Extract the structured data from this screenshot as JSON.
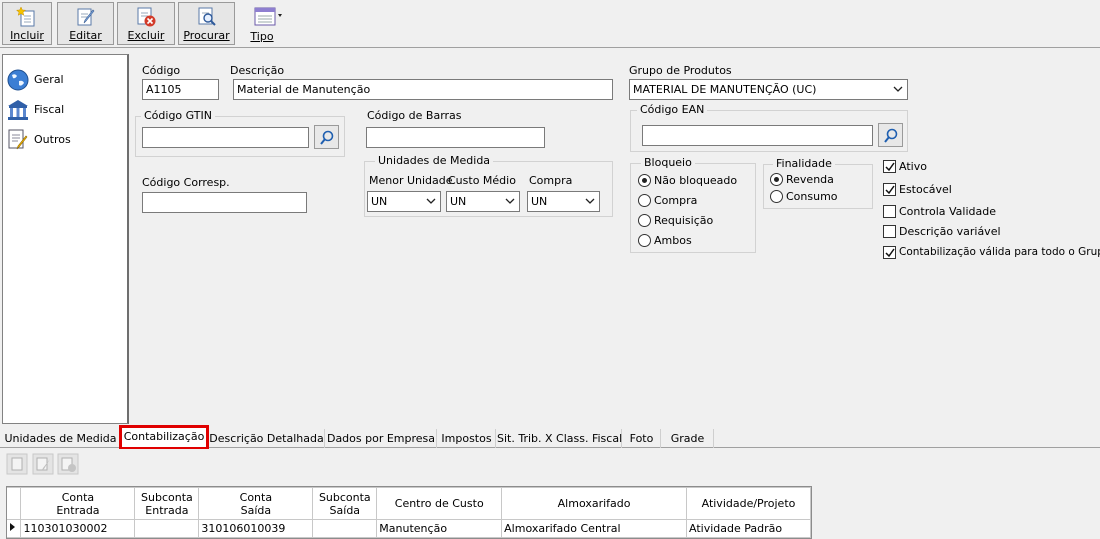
{
  "toolbar": {
    "incluir": "Incluir",
    "editar": "Editar",
    "excluir": "Excluir",
    "procurar": "Procurar",
    "tipo": "Tipo"
  },
  "nav": {
    "items": [
      {
        "label": "Geral",
        "icon": "globe-icon"
      },
      {
        "label": "Fiscal",
        "icon": "bank-icon"
      },
      {
        "label": "Outros",
        "icon": "document-edit-icon"
      }
    ]
  },
  "form": {
    "codigo_label": "Código",
    "codigo_value": "A1105",
    "descricao_label": "Descrição",
    "descricao_value": "Material de Manutenção",
    "grupo_label": "Grupo de Produtos",
    "grupo_value": "MATERIAL DE MANUTENÇÃO (UC)",
    "gtin_label": "Código GTIN",
    "gtin_value": "",
    "barras_label": "Código de Barras",
    "barras_value": "",
    "ean_label": "Código EAN",
    "ean_value": "",
    "corresp_label": "Código Corresp.",
    "corresp_value": "",
    "unidades": {
      "title": "Unidades de Medida",
      "menor_label": "Menor Unidade",
      "menor_value": "UN",
      "custo_label": "Custo Médio",
      "custo_value": "UN",
      "compra_label": "Compra",
      "compra_value": "UN"
    },
    "bloqueio": {
      "title": "Bloqueio",
      "options": [
        "Não bloqueado",
        "Compra",
        "Requisição",
        "Ambos"
      ],
      "selected": 0
    },
    "finalidade": {
      "title": "Finalidade",
      "options": [
        "Revenda",
        "Consumo"
      ],
      "selected": 0
    },
    "checks": [
      {
        "label": "Ativo",
        "checked": true
      },
      {
        "label": "Estocável",
        "checked": true
      },
      {
        "label": "Controla Validade",
        "checked": false
      },
      {
        "label": "Descrição variável",
        "checked": false
      },
      {
        "label": "Contabilização válida para todo o Grupo",
        "checked": true
      }
    ]
  },
  "tabs": [
    "Unidades de Medida",
    "Contabilização",
    "Descrição Detalhada",
    "Dados por Empresa",
    "Impostos",
    "Sit. Trib. X Class. Fiscal",
    "Foto",
    "Grade"
  ],
  "active_tab": "Contabilização",
  "grid": {
    "headers": [
      [
        "Conta",
        "Entrada"
      ],
      [
        "Subconta",
        "Entrada"
      ],
      [
        "Conta",
        "Saída"
      ],
      [
        "Subconta",
        "Saída"
      ],
      [
        "Centro de Custo"
      ],
      [
        "Almoxarifado"
      ],
      [
        "Atividade/Projeto"
      ]
    ],
    "rows": [
      [
        "110301030002",
        "",
        "310106010039",
        "",
        "Manutenção",
        "Almoxarifado Central",
        "Atividade Padrão"
      ]
    ]
  },
  "colors": {
    "highlight": "#e00000",
    "window_bg": "#f0f0f0"
  }
}
